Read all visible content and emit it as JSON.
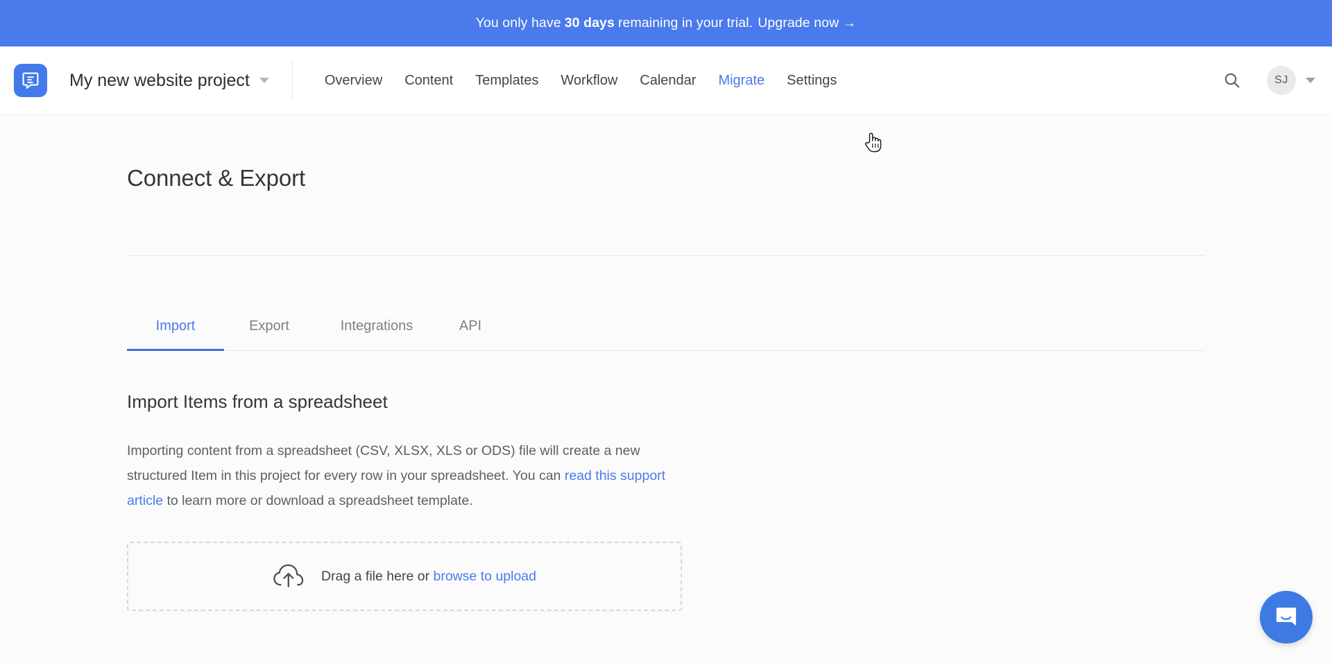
{
  "banner": {
    "text_before": "You only have",
    "days": "30 days",
    "text_after": "remaining in your trial.",
    "upgrade_label": "Upgrade now →",
    "background_color": "#4a7aeb",
    "text_color": "#ffffff"
  },
  "topnav": {
    "logo_icon": "document-logo-icon",
    "logo_color": "#437aea",
    "project_name": "My new website project",
    "project_caret_icon": "chevron-down-icon",
    "links": [
      {
        "label": "Overview",
        "active": false
      },
      {
        "label": "Content",
        "active": false
      },
      {
        "label": "Templates",
        "active": false
      },
      {
        "label": "Workflow",
        "active": false
      },
      {
        "label": "Calendar",
        "active": false
      },
      {
        "label": "Migrate",
        "active": true
      },
      {
        "label": "Settings",
        "active": false
      }
    ],
    "search_icon": "search-icon",
    "avatar_initials": "SJ",
    "avatar_caret_icon": "chevron-down-icon",
    "hover_color": "#4a7aeb"
  },
  "page": {
    "title": "Connect & Export"
  },
  "tabs": [
    {
      "label": "Import",
      "active": true
    },
    {
      "label": "Export",
      "active": false
    },
    {
      "label": "Integrations",
      "active": false
    },
    {
      "label": "API",
      "active": false
    }
  ],
  "import_panel": {
    "heading": "Import Items from a spreadsheet",
    "desc_part1": "Importing content from a spreadsheet (CSV, XLSX, XLS or ODS) file will create a new structured Item in this project for every row in your spreadsheet. You can ",
    "desc_link": "read this support article",
    "desc_part2": " to learn more or download a spreadsheet template.",
    "dropzone": {
      "icon": "cloud-upload-icon",
      "text": "Drag a file here or ",
      "link_label": "browse to upload"
    }
  },
  "chat": {
    "launcher_icon": "chat-bubble-icon",
    "color": "#3d7ae4"
  },
  "cursor": {
    "icon": "pointer-hand-cursor"
  }
}
